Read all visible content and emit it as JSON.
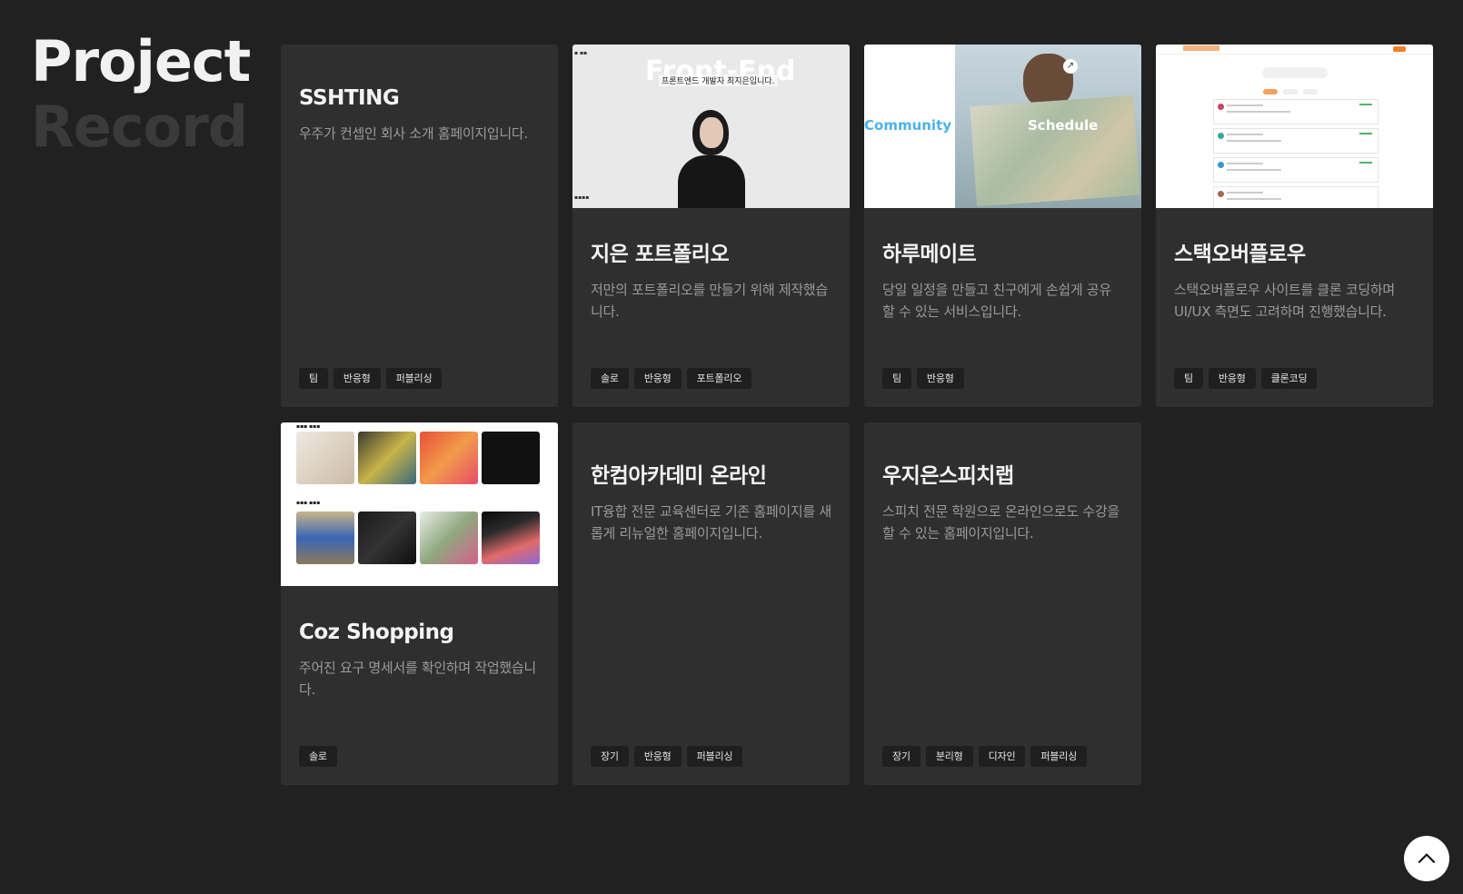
{
  "heading": {
    "line1": "Project",
    "line2": "Record"
  },
  "projects": [
    {
      "title": "SSHTING",
      "desc": "우주가 컨셉인 회사 소개 홈페이지입니다.",
      "tags": [
        "팀",
        "반응형",
        "퍼블리싱"
      ]
    },
    {
      "title": "지은 포트폴리오",
      "desc": "저만의 포트폴리오를 만들기 위해 제작했습니다.",
      "tags": [
        "솔로",
        "반응형",
        "포트폴리오"
      ],
      "thumb": {
        "big": "Front-End",
        "small": "프론트엔드 개발자 최지은입니다."
      }
    },
    {
      "title": "하루메이트",
      "desc": "당일 일정을 만들고 친구에게 손쉽게 공유할 수 있는 서비스입니다.",
      "tags": [
        "팀",
        "반응형"
      ],
      "thumb": {
        "left": "Community",
        "right": "Schedule"
      }
    },
    {
      "title": "스택오버플로우",
      "desc": "스택오버플로우 사이트를 클론 코딩하며 UI/UX 측면도 고려하며 진행했습니다.",
      "tags": [
        "팀",
        "반응형",
        "클론코딩"
      ]
    },
    {
      "title": "Coz Shopping",
      "desc": "주어진 요구 명세서를 확인하며 작업했습니다.",
      "tags": [
        "솔로"
      ]
    },
    {
      "title": "한컴아카데미 온라인",
      "desc": "IT융합 전문 교육센터로 기존 홈페이지를 새롭게 리뉴얼한 홈페이지입니다.",
      "tags": [
        "장기",
        "반응형",
        "퍼블리싱"
      ]
    },
    {
      "title": "우지은스피치랩",
      "desc": "스피치 전문 학원으로 온라인으로도 수강을 할 수 있는 홈페이지입니다.",
      "tags": [
        "장기",
        "분리형",
        "디자인",
        "퍼블리싱"
      ]
    }
  ]
}
